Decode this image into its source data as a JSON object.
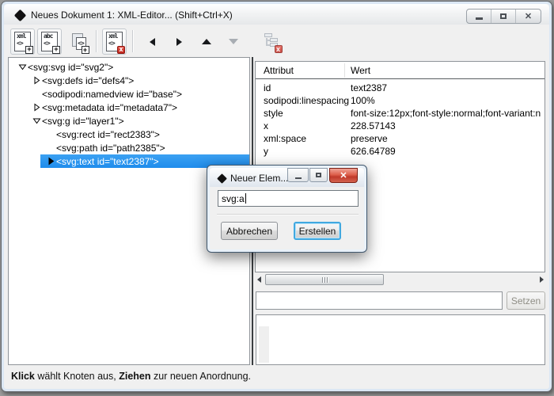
{
  "window": {
    "title": "Neues Dokument 1: XML-Editor... (Shift+Ctrl+X)"
  },
  "toolbar": {
    "new_element": {
      "line1": "xml",
      "line2": "<>",
      "badge": "+"
    },
    "new_text": {
      "line1": "abc",
      "line2": "<>",
      "badge": "+"
    },
    "duplicate": {
      "line2": "<>",
      "badge": "+"
    },
    "delete_node": {
      "line1": "xml",
      "line2": "<>",
      "badge": "x"
    },
    "delete_attribute_badge": "x"
  },
  "tree": {
    "nodes": [
      {
        "text": "<svg:svg id=\"svg2\">",
        "expander": "expanded",
        "level": 0
      },
      {
        "text": "<svg:defs id=\"defs4\">",
        "expander": "collapsed",
        "level": 1
      },
      {
        "text": "<sodipodi:namedview id=\"base\">",
        "expander": "none",
        "level": 1
      },
      {
        "text": "<svg:metadata id=\"metadata7\">",
        "expander": "collapsed",
        "level": 1
      },
      {
        "text": "<svg:g id=\"layer1\">",
        "expander": "expanded",
        "level": 1
      },
      {
        "text": "<svg:rect id=\"rect2383\">",
        "expander": "none",
        "level": 2
      },
      {
        "text": "<svg:path id=\"path2385\">",
        "expander": "none",
        "level": 2
      },
      {
        "text": "<svg:text id=\"text2387\">",
        "expander": "collapsed",
        "level": 2,
        "selected": true
      }
    ]
  },
  "attributes": {
    "columns": {
      "name": "Attribut",
      "value": "Wert"
    },
    "rows": [
      {
        "name": "id",
        "value": "text2387"
      },
      {
        "name": "sodipodi:linespacing",
        "value": "100%"
      },
      {
        "name": "style",
        "value": "font-size:12px;font-style:normal;font-variant:n"
      },
      {
        "name": "x",
        "value": "228.57143"
      },
      {
        "name": "xml:space",
        "value": "preserve"
      },
      {
        "name": "y",
        "value": "626.64789"
      }
    ],
    "value_input": {
      "value": "",
      "placeholder": ""
    },
    "set_button": "Setzen"
  },
  "dialog": {
    "title": "Neuer Elem...",
    "input_value": "svg:a",
    "cancel_button": "Abbrechen",
    "create_button": "Erstellen"
  },
  "statusbar": {
    "part1_bold": "Klick",
    "part2": " wählt Knoten aus, ",
    "part3_bold": "Ziehen",
    "part4": " zur neuen Anordnung."
  }
}
